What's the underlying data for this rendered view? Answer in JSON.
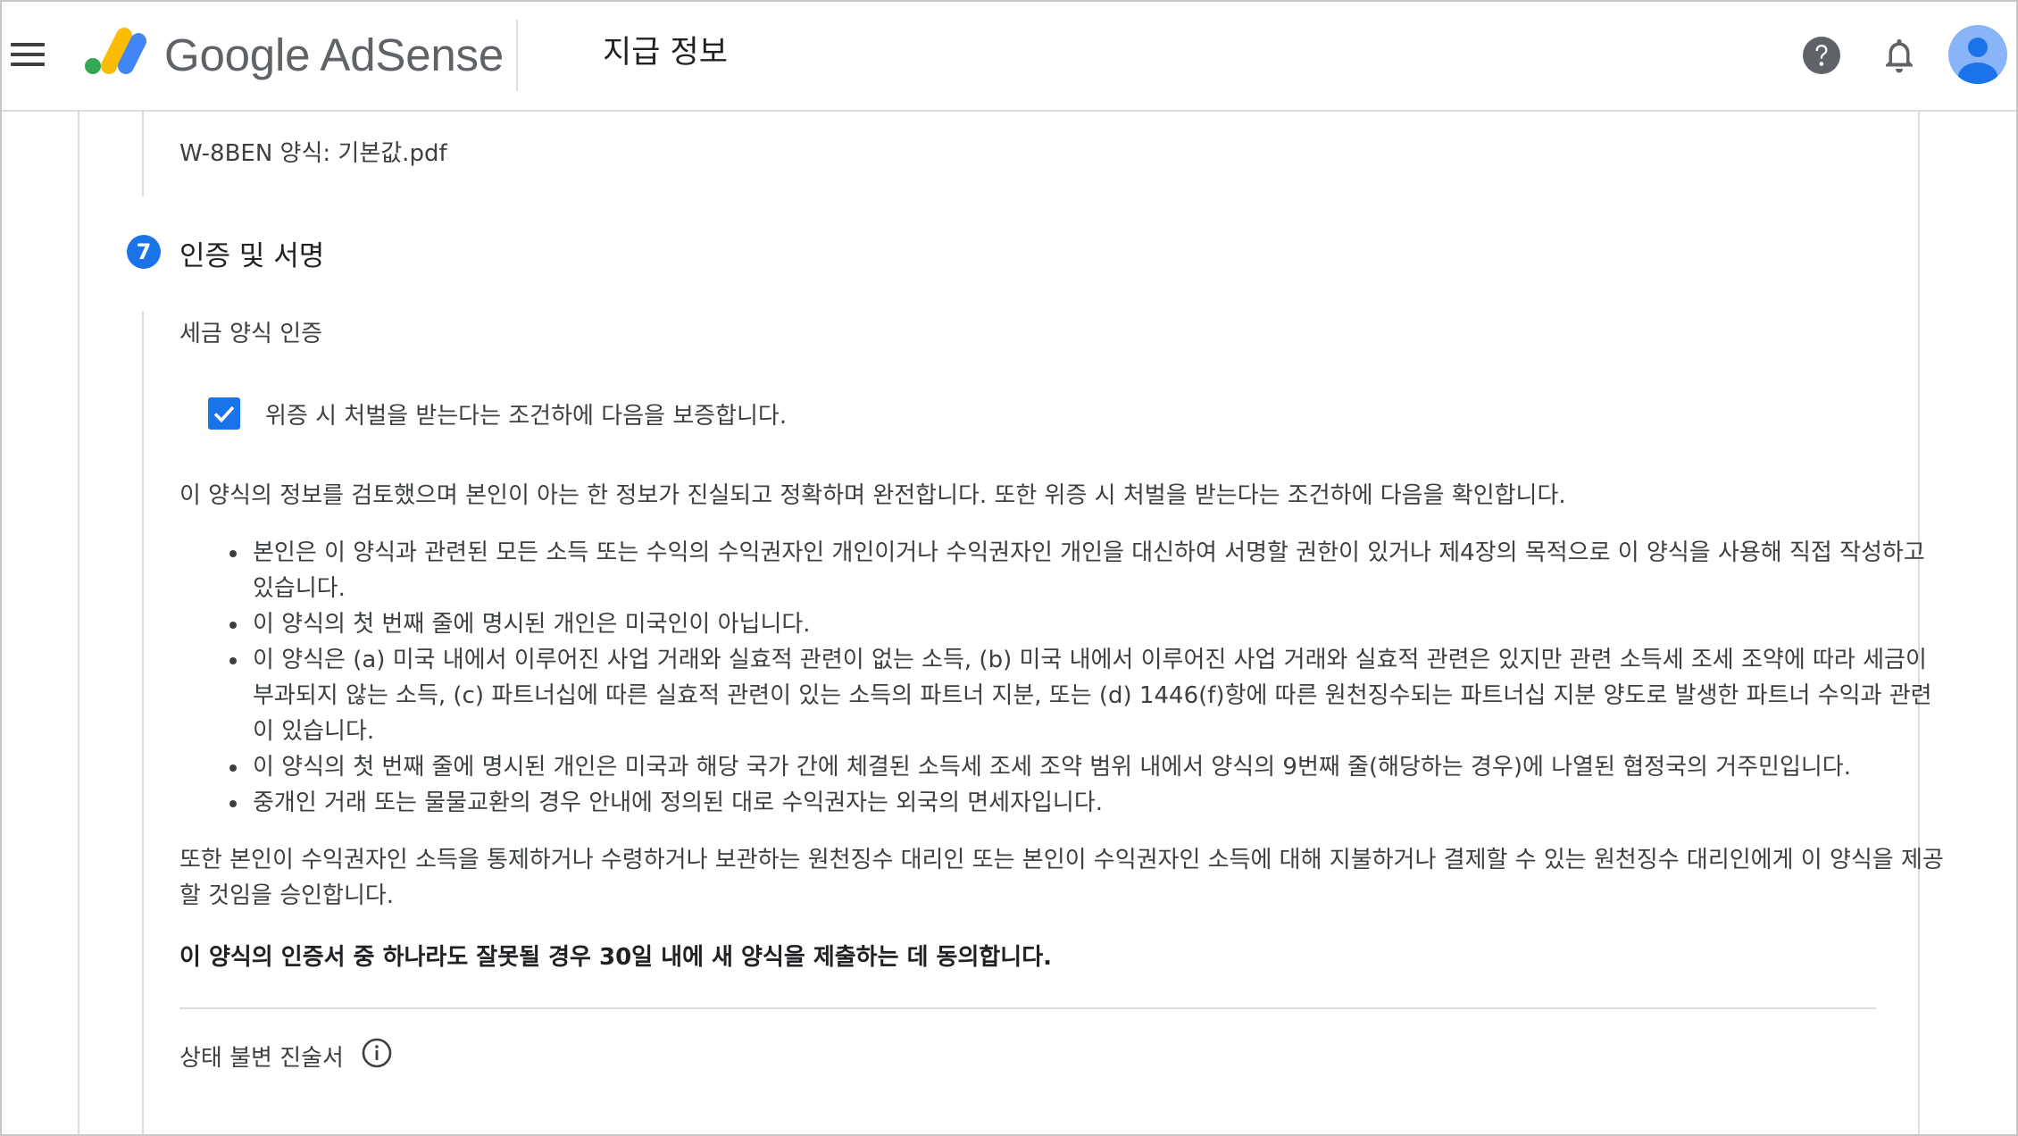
{
  "header": {
    "brand": "Google AdSense",
    "page_title": "지급 정보",
    "icons": [
      "menu-icon",
      "adsense-logo-icon",
      "help-icon",
      "bell-icon",
      "account-avatar"
    ]
  },
  "form": {
    "file_line": "W-8BEN 양식: 기본값.pdf",
    "step_number": "7",
    "step_title": "인증 및 서명",
    "sub_heading": "세금 양식 인증",
    "checkbox_checked": true,
    "checkbox_label": "위증 시 처벌을 받는다는 조건하에 다음을 보증합니다.",
    "intro": "이 양식의 정보를 검토했으며 본인이 아는 한 정보가 진실되고 정확하며 완전합니다. 또한 위증 시 처벌을 받는다는 조건하에 다음을 확인합니다.",
    "bullets": [
      "본인은 이 양식과 관련된 모든 소득 또는 수익의 수익권자인 개인이거나 수익권자인 개인을 대신하여 서명할 권한이 있거나 제4장의 목적으로 이 양식을 사용해 직접 작성하고 있습니다.",
      "이 양식의 첫 번째 줄에 명시된 개인은 미국인이 아닙니다.",
      "이 양식은 (a) 미국 내에서 이루어진 사업 거래와 실효적 관련이 없는 소득, (b) 미국 내에서 이루어진 사업 거래와 실효적 관련은 있지만 관련 소득세 조세 조약에 따라 세금이 부과되지 않는 소득, (c) 파트너십에 따른 실효적 관련이 있는 소득의 파트너 지분, 또는 (d) 1446(f)항에 따른 원천징수되는 파트너십 지분 양도로 발생한 파트너 수익과 관련이 있습니다.",
      "이 양식의 첫 번째 줄에 명시된 개인은 미국과 해당 국가 간에 체결된 소득세 조세 조약 범위 내에서 양식의 9번째 줄(해당하는 경우)에 나열된 협정국의 거주민입니다.",
      "중개인 거래 또는 물물교환의 경우 안내에 정의된 대로 수익권자는 외국의 면세자입니다."
    ],
    "consent": "또한 본인이 수익권자인 소득을 통제하거나 수령하거나 보관하는 원천징수 대리인 또는 본인이 수익권자인 소득에 대해 지불하거나 결제할 수 있는 원천징수 대리인에게 이 양식을 제공할 것임을 승인합니다.",
    "agree": "이 양식의 인증서 중 하나라도 잘못될 경우 30일 내에 새 양식을 제출하는 데 동의합니다.",
    "status_title": "상태 불변 진술서"
  },
  "colors": {
    "accent": "#1a73e8",
    "logo_yellow": "#fbbc04",
    "logo_green": "#34a853",
    "logo_blue": "#4285f4",
    "avatar_bg": "#8ab4f8",
    "avatar_fg": "#1a73e8"
  }
}
